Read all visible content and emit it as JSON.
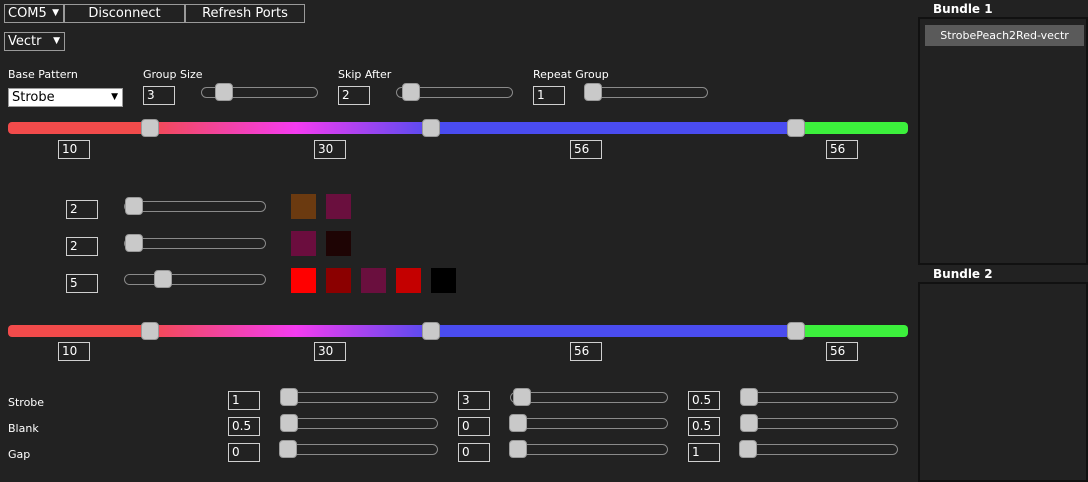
{
  "top": {
    "port_select": "COM5",
    "disconnect_label": "Disconnect",
    "refresh_label": "Refresh Ports",
    "device_select": "Vectr"
  },
  "params": {
    "base_pattern_label": "Base Pattern",
    "base_pattern_value": "Strobe",
    "group_size_label": "Group Size",
    "group_size_value": "3",
    "skip_after_label": "Skip After",
    "skip_after_value": "2",
    "repeat_group_label": "Repeat Group",
    "repeat_group_value": "1"
  },
  "timeline1": {
    "values": [
      "10",
      "30",
      "56",
      "56"
    ]
  },
  "color_rows": [
    {
      "count": "2",
      "swatches": [
        "#6b3a10",
        "#6a0f3e"
      ]
    },
    {
      "count": "2",
      "swatches": [
        "#6b0d3e",
        "#1e0404"
      ]
    },
    {
      "count": "5",
      "swatches": [
        "#ff0000",
        "#8b0000",
        "#6a0f3e",
        "#c40000",
        "#000000"
      ]
    }
  ],
  "timeline2": {
    "values": [
      "10",
      "30",
      "56",
      "56"
    ]
  },
  "timing": {
    "rows": [
      {
        "label": "Strobe",
        "values": [
          "1",
          "3",
          "0.5"
        ]
      },
      {
        "label": "Blank",
        "values": [
          "0.5",
          "0",
          "0.5"
        ]
      },
      {
        "label": "Gap",
        "values": [
          "0",
          "0",
          "1"
        ]
      }
    ]
  },
  "bundles": {
    "bundle1_title": "Bundle 1",
    "bundle1_items": [
      "StrobePeach2Red-vectr"
    ],
    "bundle2_title": "Bundle 2"
  },
  "colors": {
    "background": "#222222",
    "gradient": [
      "#f24b4b",
      "#f43cf0",
      "#4a4cf0",
      "#3cf03c"
    ]
  }
}
